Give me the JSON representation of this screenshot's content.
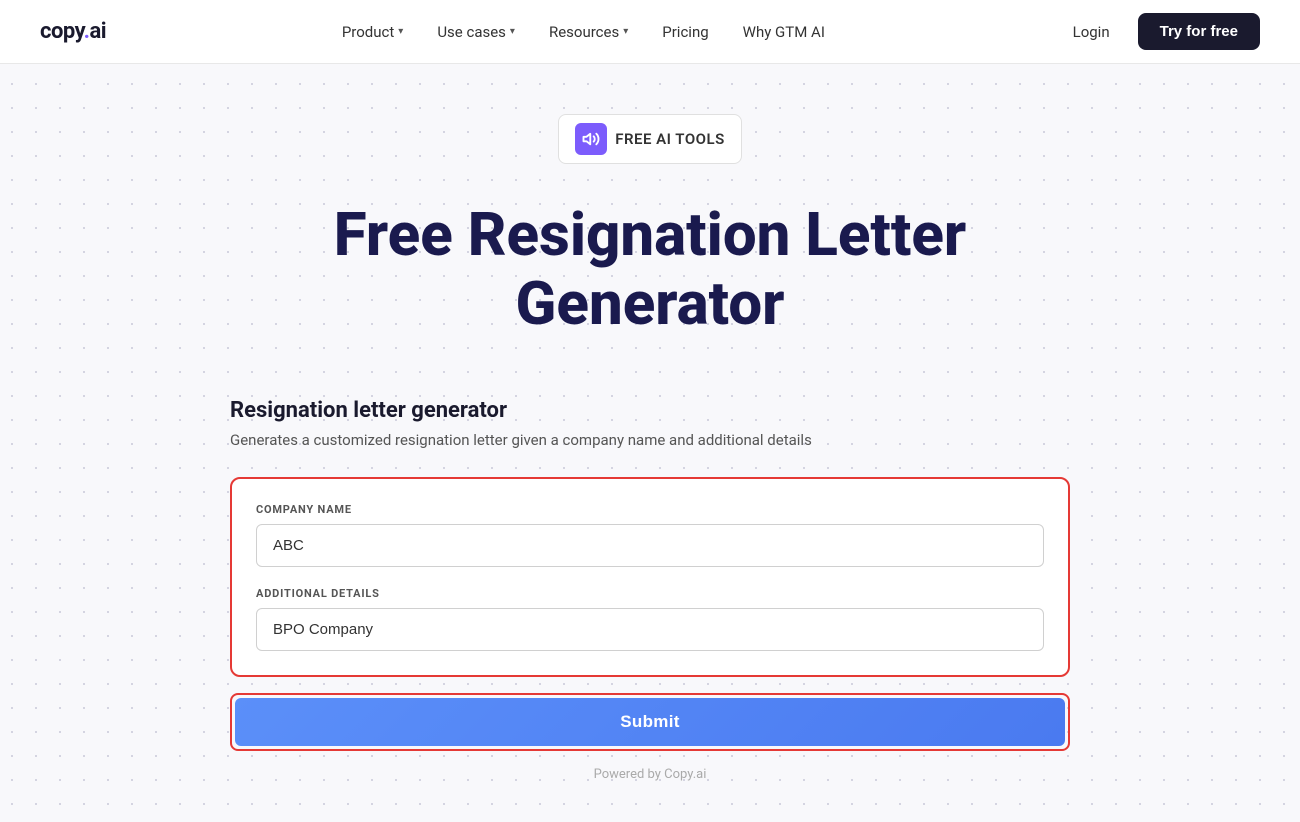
{
  "navbar": {
    "logo": "copy.ai",
    "logo_dot": ".",
    "logo_ai": "ai",
    "nav_items": [
      {
        "label": "Product",
        "has_chevron": true
      },
      {
        "label": "Use cases",
        "has_chevron": true
      },
      {
        "label": "Resources",
        "has_chevron": true
      },
      {
        "label": "Pricing",
        "has_chevron": false
      },
      {
        "label": "Why GTM AI",
        "has_chevron": false
      }
    ],
    "login_label": "Login",
    "try_label": "Try for free"
  },
  "badge": {
    "icon": "📢",
    "text": "FREE AI TOOLS"
  },
  "hero": {
    "heading_line1": "Free Resignation Letter",
    "heading_line2": "Generator"
  },
  "form_section": {
    "title": "Resignation letter generator",
    "description": "Generates a customized resignation letter given a company name and additional details",
    "company_name_label": "COMPANY NAME",
    "company_name_value": "ABC",
    "company_name_placeholder": "ABC",
    "additional_details_label": "ADDITIONAL DETAILS",
    "additional_details_value": "BPO Company",
    "additional_details_placeholder": "BPO Company",
    "submit_label": "Submit",
    "powered_by": "Powered by Copy.ai"
  },
  "colors": {
    "accent_purple": "#7c5cfc",
    "dark_navy": "#1a1a4e",
    "red_border": "#e53935",
    "button_blue": "#4a7af0"
  }
}
